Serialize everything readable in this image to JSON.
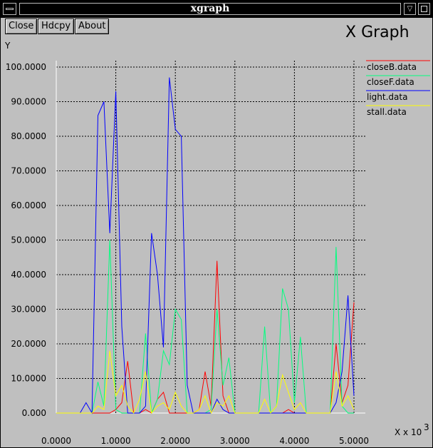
{
  "window": {
    "title": "xgraph",
    "minimize_glyph": "▽"
  },
  "toolbar": {
    "close_label": "Close",
    "hdcpy_label": "Hdcpy",
    "about_label": "About"
  },
  "graph_title": "X Graph",
  "icons": [
    "window-menu-icon",
    "minimize-icon",
    "maximize-icon"
  ],
  "chart_data": {
    "type": "line",
    "title": "X Graph",
    "xlabel": "X x 10",
    "xlabel_exponent": "3",
    "ylabel": "Y",
    "xlim": [
      0,
      5
    ],
    "ylim": [
      0,
      100
    ],
    "grid": true,
    "legend_position": "right",
    "x_tick_labels": [
      "0.0000",
      "1.0000",
      "2.0000",
      "3.0000",
      "4.0000",
      "5.0000"
    ],
    "y_tick_labels": [
      "0.000",
      "10.0000",
      "20.0000",
      "30.0000",
      "40.0000",
      "50.0000",
      "60.0000",
      "70.0000",
      "80.0000",
      "90.0000",
      "100.0000"
    ],
    "x_ticks": [
      0,
      1,
      2,
      3,
      4,
      5
    ],
    "y_ticks": [
      0,
      10,
      20,
      30,
      40,
      50,
      60,
      70,
      80,
      90,
      100
    ],
    "series": [
      {
        "name": "closeB.data",
        "color": "#ff0000",
        "x": [
          0,
          0.5,
          0.7,
          0.9,
          1.0,
          1.1,
          1.2,
          1.3,
          1.4,
          1.5,
          1.6,
          1.7,
          1.8,
          1.9,
          2.0,
          2.1,
          2.2,
          2.3,
          2.4,
          2.5,
          2.6,
          2.7,
          2.8,
          2.9,
          3.0,
          3.5,
          3.8,
          3.9,
          4.0,
          4.5,
          4.6,
          4.7,
          4.8,
          4.9,
          5.0
        ],
        "values": [
          0,
          0,
          0,
          0,
          1,
          3,
          15,
          0,
          0,
          1,
          0,
          4,
          6,
          0,
          0,
          0,
          0,
          0,
          1,
          12,
          2,
          44,
          5,
          0,
          0,
          0,
          0,
          1,
          0,
          0,
          0,
          20,
          3,
          8,
          32
        ]
      },
      {
        "name": "closeF.data",
        "color": "#00ff7f",
        "x": [
          0,
          0.6,
          0.7,
          0.8,
          0.9,
          1.0,
          1.1,
          1.2,
          1.3,
          1.4,
          1.5,
          1.6,
          1.7,
          1.8,
          1.9,
          2.0,
          2.1,
          2.2,
          2.3,
          2.4,
          2.5,
          2.6,
          2.7,
          2.8,
          2.9,
          3.0,
          3.3,
          3.4,
          3.5,
          3.6,
          3.7,
          3.8,
          3.9,
          4.0,
          4.1,
          4.2,
          4.3,
          4.6,
          4.7,
          4.8,
          4.9,
          5.0
        ],
        "values": [
          0,
          0,
          9,
          2,
          50,
          1,
          0,
          0,
          0,
          0,
          23,
          0,
          4,
          18,
          14,
          30,
          27,
          0,
          0,
          0,
          0,
          1,
          30,
          8,
          16,
          0,
          0,
          0,
          25,
          0,
          2,
          36,
          30,
          3,
          22,
          0,
          0,
          0,
          48,
          2,
          0,
          0
        ]
      },
      {
        "name": "light.data",
        "color": "#0000ff",
        "x": [
          0,
          0.4,
          0.5,
          0.6,
          0.7,
          0.8,
          0.9,
          1.0,
          1.1,
          1.2,
          1.3,
          1.4,
          1.5,
          1.6,
          1.7,
          1.8,
          1.9,
          2.0,
          2.1,
          2.2,
          2.3,
          2.6,
          2.7,
          2.8,
          2.9,
          3.0,
          4.6,
          4.7,
          4.8,
          4.9,
          5.0
        ],
        "values": [
          0,
          0,
          3,
          0,
          86,
          90,
          52,
          93,
          25,
          0,
          0,
          0,
          2,
          52,
          40,
          19,
          97,
          82,
          80,
          8,
          0,
          0,
          4,
          1,
          0,
          0,
          0,
          3,
          12,
          34,
          5
        ]
      },
      {
        "name": "stall.data",
        "color": "#ffff00",
        "x": [
          0,
          0.6,
          0.7,
          0.8,
          0.9,
          1.0,
          1.1,
          1.2,
          1.3,
          1.4,
          1.5,
          1.6,
          1.7,
          1.8,
          1.9,
          2.0,
          2.1,
          2.2,
          2.3,
          2.4,
          2.5,
          2.6,
          2.7,
          2.8,
          2.9,
          3.0,
          3.4,
          3.5,
          3.6,
          3.7,
          3.8,
          3.9,
          4.0,
          4.1,
          4.2,
          4.3,
          4.6,
          4.7,
          4.8,
          4.9,
          5.0
        ],
        "values": [
          0,
          0,
          2,
          1,
          18,
          5,
          8,
          2,
          0,
          4,
          12,
          0,
          2,
          3,
          1,
          6,
          2,
          0,
          0,
          1,
          5,
          0,
          3,
          2,
          5,
          0,
          0,
          4,
          0,
          2,
          11,
          6,
          1,
          3,
          0,
          0,
          0,
          12,
          2,
          5,
          1
        ]
      }
    ]
  }
}
